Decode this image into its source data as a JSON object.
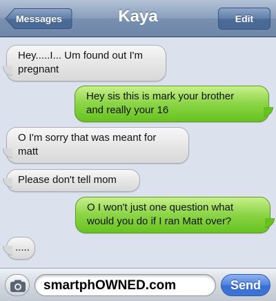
{
  "navbar": {
    "title": "Kaya",
    "back_label": "Messages",
    "edit_label": "Edit"
  },
  "messages": [
    {
      "direction": "incoming",
      "line1": "Hey.....I... Um found out I'm",
      "line2": "pregnant"
    },
    {
      "direction": "outgoing",
      "line1": "Hey sis this is mark your brother",
      "line2": "and really your 16"
    },
    {
      "direction": "incoming",
      "line1": "O I'm sorry that was meant for",
      "line2": "matt"
    },
    {
      "direction": "incoming",
      "line1": "Please don't tell mom"
    },
    {
      "direction": "outgoing",
      "line1": "O I won't just one question what",
      "line2": "would you do if I ran Matt over?"
    },
    {
      "direction": "incoming",
      "line1": "....."
    }
  ],
  "composer": {
    "input_value": "smartphOWNED.com",
    "send_label": "Send",
    "camera_icon": "camera-icon"
  },
  "colors": {
    "nav_bar": "#7990b0",
    "background": "#dbe2ed",
    "incoming_bubble": "#e6e6e6",
    "outgoing_bubble": "#8fd64b",
    "send_button": "#3e74d6"
  }
}
